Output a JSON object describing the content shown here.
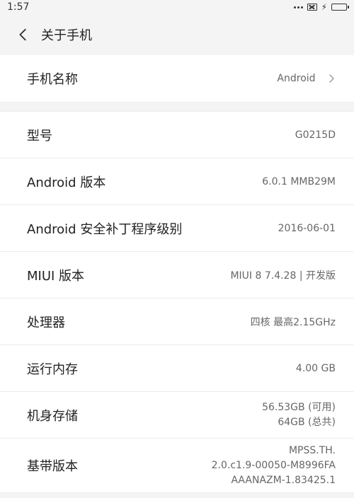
{
  "statusbar": {
    "time": "1:57"
  },
  "appbar": {
    "title": "关于手机"
  },
  "device_name_section": {
    "label": "手机名称",
    "value": "Android"
  },
  "info_rows": [
    {
      "label": "型号",
      "value_lines": [
        "G0215D"
      ]
    },
    {
      "label": "Android 版本",
      "value_lines": [
        "6.0.1 MMB29M"
      ]
    },
    {
      "label": "Android 安全补丁程序级别",
      "value_lines": [
        "2016-06-01"
      ]
    },
    {
      "label": "MIUI 版本",
      "value_lines": [
        "MIUI 8 7.4.28 | 开发版"
      ]
    },
    {
      "label": "处理器",
      "value_lines": [
        "四核 最高2.15GHz"
      ]
    },
    {
      "label": "运行内存",
      "value_lines": [
        "4.00 GB"
      ]
    },
    {
      "label": "机身存储",
      "value_lines": [
        "56.53GB (可用)",
        "64GB (总共)"
      ]
    },
    {
      "label": "基带版本",
      "value_lines": [
        "MPSS.TH.",
        "2.0.c1.9-00050-M8996FA",
        "AAANAZM-1.83425.1"
      ]
    }
  ],
  "icons": {
    "back": "back-chevron-icon",
    "chevron_right": "chevron-right-icon",
    "more": "more-dots-icon",
    "sim": "no-sim-icon",
    "charging": "charging-bolt-icon",
    "battery": "battery-icon"
  },
  "colors": {
    "background": "#f4f4f4",
    "card": "#ffffff",
    "primary_text": "#222222",
    "secondary_text": "#666666"
  }
}
